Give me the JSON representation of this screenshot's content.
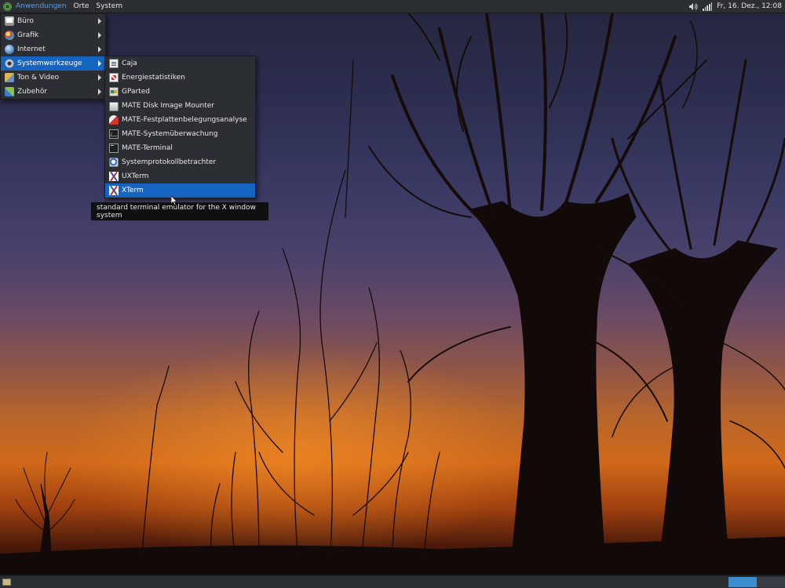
{
  "top_panel": {
    "menus": [
      {
        "label": "Anwendungen",
        "active": true
      },
      {
        "label": "Orte",
        "active": false
      },
      {
        "label": "System",
        "active": false
      }
    ],
    "tray": {
      "volume_icon": "speaker-icon",
      "network_icon": "signal-bars-icon",
      "clock": "Fr, 16. Dez., 12:08"
    }
  },
  "applications_menu": {
    "items": [
      {
        "label": "Büro",
        "icon": "office-icon",
        "has_submenu": true
      },
      {
        "label": "Grafik",
        "icon": "graphics-icon",
        "has_submenu": true
      },
      {
        "label": "Internet",
        "icon": "internet-icon",
        "has_submenu": true
      },
      {
        "label": "Systemwerkzeuge",
        "icon": "system-tools-icon",
        "has_submenu": true,
        "selected": true
      },
      {
        "label": "Ton & Video",
        "icon": "sound-video-icon",
        "has_submenu": true
      },
      {
        "label": "Zubehör",
        "icon": "accessories-icon",
        "has_submenu": true
      }
    ]
  },
  "system_tools_submenu": {
    "items": [
      {
        "label": "Caja",
        "icon": "file-manager-icon"
      },
      {
        "label": "Energiestatistiken",
        "icon": "power-statistics-icon"
      },
      {
        "label": "GParted",
        "icon": "gparted-icon"
      },
      {
        "label": "MATE Disk Image Mounter",
        "icon": "disk-image-icon"
      },
      {
        "label": "MATE-Festplattenbelegungsanalyse",
        "icon": "disk-usage-icon"
      },
      {
        "label": "MATE-Systemüberwachung",
        "icon": "system-monitor-icon"
      },
      {
        "label": "MATE-Terminal",
        "icon": "terminal-icon"
      },
      {
        "label": "Systemprotokollbetrachter",
        "icon": "log-viewer-icon"
      },
      {
        "label": "UXTerm",
        "icon": "x-icon"
      },
      {
        "label": "XTerm",
        "icon": "x-icon",
        "selected": true
      }
    ]
  },
  "tooltip": {
    "text": "standard terminal emulator for the X window system"
  },
  "bottom_panel": {
    "workspaces": [
      {
        "active": true
      },
      {
        "active": false
      }
    ]
  },
  "colors": {
    "panel": "#2b2e33",
    "menu_selection": "#1565c0",
    "active_menu_text": "#4aa3ff",
    "workspace_active": "#3c8dcf"
  }
}
